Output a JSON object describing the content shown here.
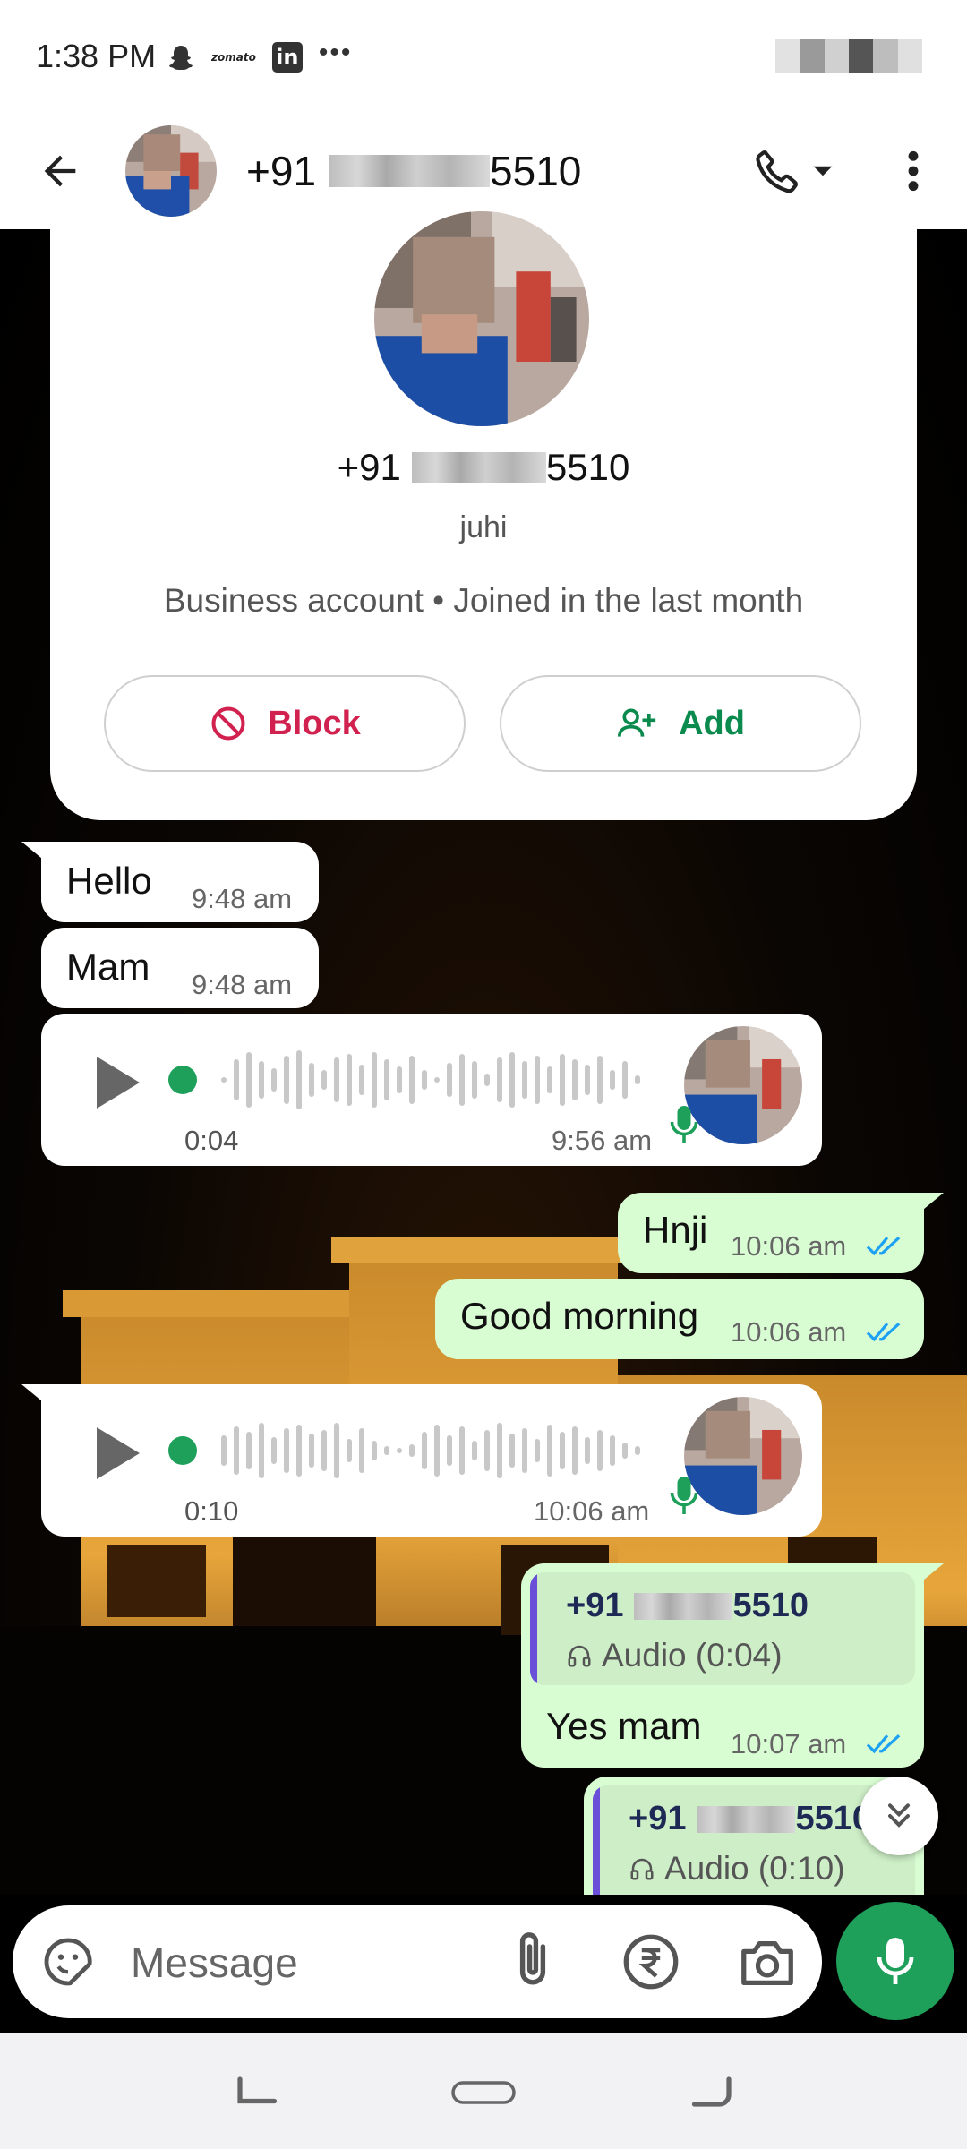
{
  "status_bar": {
    "time": "1:38 PM",
    "notification_icons": [
      "snapchat-icon",
      "zomato-icon",
      "linkedin-icon"
    ],
    "zomato_text": "zomato",
    "linkedin_text": "in",
    "more": "•••"
  },
  "header": {
    "number_prefix": "+91",
    "number_suffix": "5510",
    "icons": [
      "back-arrow-icon",
      "phone-icon",
      "dropdown-caret-icon",
      "more-vert-icon"
    ]
  },
  "contact_card": {
    "number_prefix": "+91",
    "number_suffix": "5510",
    "name": "juhi",
    "info": "Business account • Joined in the last month",
    "block_label": "Block",
    "add_label": "Add"
  },
  "messages": {
    "m1": {
      "text": "Hello",
      "time": "9:48 am"
    },
    "m2": {
      "text": "Mam",
      "time": "9:48 am"
    },
    "vm1": {
      "duration": "0:04",
      "time": "9:56 am"
    },
    "m3": {
      "text": "Hnji",
      "time": "10:06 am",
      "status": "read"
    },
    "m4": {
      "text": "Good morning",
      "time": "10:06 am",
      "status": "read"
    },
    "vm2": {
      "duration": "0:10",
      "time": "10:06 am"
    },
    "m5": {
      "quote_prefix": "+91",
      "quote_suffix": "5510",
      "quote_audio": "Audio (0:04)",
      "text": "Yes mam",
      "time": "10:07 am",
      "status": "read"
    },
    "m6": {
      "quote_prefix": "+91",
      "quote_suffix": "5510",
      "quote_audio": "Audio (0:10)"
    }
  },
  "composer": {
    "placeholder": "Message",
    "icons": [
      "sticker-icon",
      "attach-icon",
      "rupee-icon",
      "camera-icon",
      "mic-icon"
    ]
  },
  "colors": {
    "accent_green": "#1ea05a",
    "outgoing_bubble": "#d9fdd3",
    "read_ticks": "#1da1f2",
    "block_red": "#d1224f",
    "add_green": "#0a8a4c",
    "quote_bar": "#6a4fd8"
  }
}
